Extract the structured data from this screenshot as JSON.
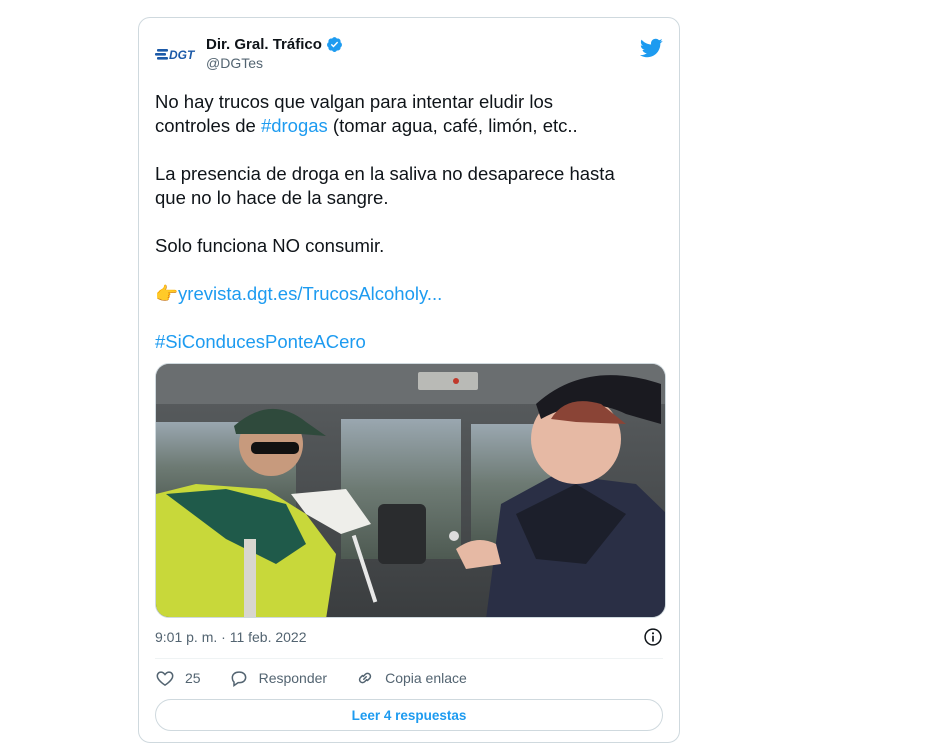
{
  "tweet": {
    "author_name": "Dir. Gral. Tráfico",
    "author_handle": "@DGTes",
    "logo_text": "DGT",
    "line1a": "No hay trucos que valgan para intentar eludir los",
    "line1b_pre": "controles de ",
    "hashtag_drogas": "#drogas",
    "line1b_post": " (tomar agua, café, limón, etc..",
    "para2": "La presencia de droga en la saliva no desaparece hasta que no lo hace de la sangre.",
    "para3": "Solo funciona NO consumir.",
    "emoji_pointer": "👉",
    "link_text": "yrevista.dgt.es/TrucosAlcoholy...",
    "hashtag_campaign": "#SiConducesPonteACero",
    "timestamp": "9:01 p. m. · 11 feb. 2022",
    "likes": "25",
    "reply_label": "Responder",
    "copy_label": "Copia enlace",
    "read_replies": "Leer 4 respuestas"
  },
  "colors": {
    "accent": "#1d9bf0",
    "like": "#536471",
    "text": "#0f1419",
    "secondary": "#536471",
    "dgt_blue": "#1c5aa8"
  },
  "icons": [
    "dgt-logo-icon",
    "verified-badge-icon",
    "twitter-bird-icon",
    "pointing-hand-emoji",
    "info-icon",
    "heart-icon",
    "reply-icon",
    "link-icon"
  ]
}
